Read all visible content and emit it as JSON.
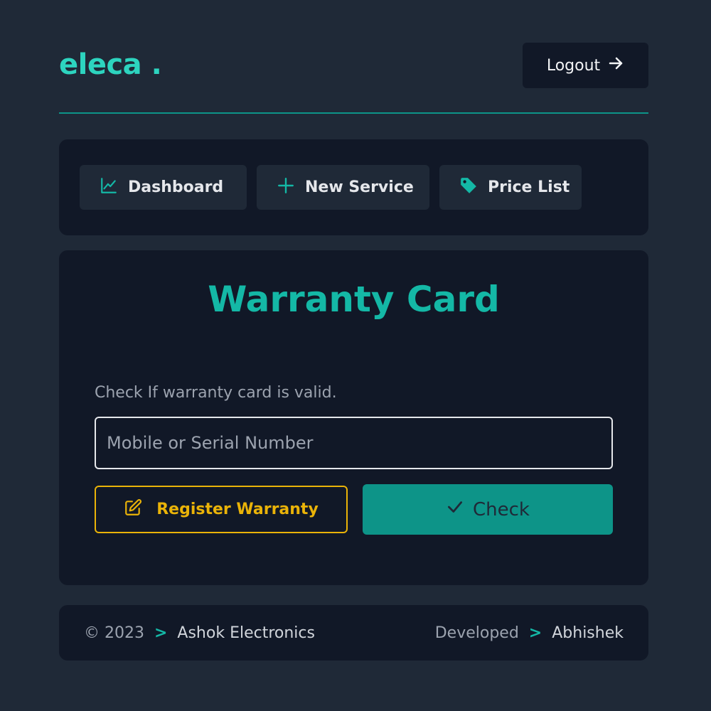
{
  "header": {
    "logo": "eleca .",
    "logout_label": "Logout"
  },
  "nav": {
    "items": [
      {
        "label": "Dashboard",
        "icon": "chart-line-icon"
      },
      {
        "label": "New Service",
        "icon": "plus-icon"
      },
      {
        "label": "Price List",
        "icon": "tag-icon"
      }
    ]
  },
  "warranty": {
    "title": "Warranty Card",
    "helper": "Check If warranty card is valid.",
    "input_placeholder": "Mobile or Serial Number",
    "input_value": "",
    "register_label": "Register Warranty",
    "check_label": "Check"
  },
  "footer": {
    "copyright": "© 2023",
    "company": "Ashok Electronics",
    "developed": "Developed",
    "developer": "Abhishek",
    "separator": ">"
  },
  "colors": {
    "background": "#1f2937",
    "panel": "#111827",
    "accent": "#14b8a6",
    "accent_dark": "#0d9488",
    "warning": "#eab308"
  }
}
